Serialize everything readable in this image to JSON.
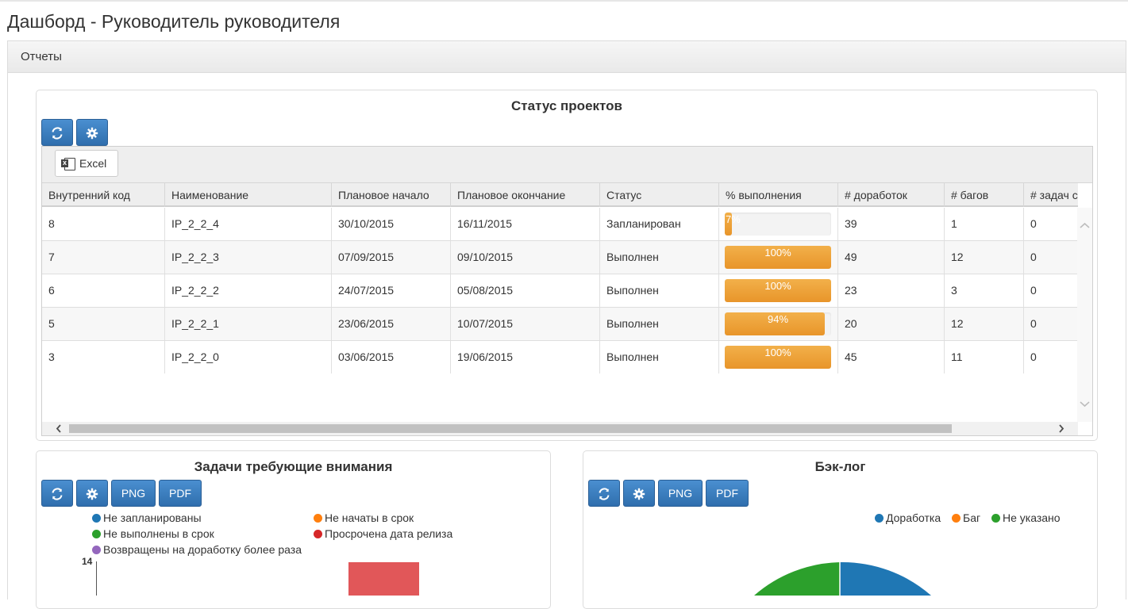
{
  "page": {
    "title": "Дашборд - Руководитель руководителя"
  },
  "reports": {
    "header": "Отчеты"
  },
  "icons": {
    "refresh": "refresh-icon",
    "settings": "gear-icon",
    "excel": "excel-icon"
  },
  "project_status": {
    "title": "Статус проектов",
    "excel_label": "Excel",
    "columns": [
      "Внутренний код",
      "Наименование",
      "Плановое начало",
      "Плановое окончание",
      "Статус",
      "% выполнения",
      "# доработок",
      "# багов",
      "# задач с"
    ],
    "rows": [
      {
        "code": "8",
        "name": "IP_2_2_4",
        "start": "30/10/2015",
        "end": "16/11/2015",
        "status": "Запланирован",
        "progress": 7,
        "progress_label": "7%",
        "rework": "39",
        "bugs": "1",
        "tasks": "0"
      },
      {
        "code": "7",
        "name": "IP_2_2_3",
        "start": "07/09/2015",
        "end": "09/10/2015",
        "status": "Выполнен",
        "progress": 100,
        "progress_label": "100%",
        "rework": "49",
        "bugs": "12",
        "tasks": "0"
      },
      {
        "code": "6",
        "name": "IP_2_2_2",
        "start": "24/07/2015",
        "end": "05/08/2015",
        "status": "Выполнен",
        "progress": 100,
        "progress_label": "100%",
        "rework": "23",
        "bugs": "3",
        "tasks": "0"
      },
      {
        "code": "5",
        "name": "IP_2_2_1",
        "start": "23/06/2015",
        "end": "10/07/2015",
        "status": "Выполнен",
        "progress": 94,
        "progress_label": "94%",
        "rework": "20",
        "bugs": "12",
        "tasks": "0"
      },
      {
        "code": "3",
        "name": "IP_2_2_0",
        "start": "03/06/2015",
        "end": "19/06/2015",
        "status": "Выполнен",
        "progress": 100,
        "progress_label": "100%",
        "rework": "45",
        "bugs": "11",
        "tasks": "0"
      }
    ]
  },
  "tasks_attention": {
    "title": "Задачи требующие внимания",
    "png_label": "PNG",
    "pdf_label": "PDF",
    "legend": [
      {
        "label": "Не запланированы",
        "color": "#1f77b4"
      },
      {
        "label": "Не начаты в срок",
        "color": "#ff7f0e"
      },
      {
        "label": "Не выполнены в срок",
        "color": "#2ca02c"
      },
      {
        "label": "Просрочена дата релиза",
        "color": "#d62728"
      },
      {
        "label": "Возвращены на доработку более раза",
        "color": "#9467bd"
      }
    ],
    "y_max_label": "14",
    "bar_color": "#e15759"
  },
  "backlog": {
    "title": "Бэк-лог",
    "png_label": "PNG",
    "pdf_label": "PDF",
    "legend": [
      {
        "label": "Доработка",
        "color": "#1f77b4"
      },
      {
        "label": "Баг",
        "color": "#ff7f0e"
      },
      {
        "label": "Не указано",
        "color": "#2ca02c"
      }
    ]
  },
  "chart_data": [
    {
      "type": "bar",
      "title": "Задачи требующие внимания",
      "ymax_tick": 14,
      "series": [
        {
          "name": "Просрочена дата релиза",
          "values": [
            14
          ]
        }
      ]
    },
    {
      "type": "pie",
      "title": "Бэк-лог",
      "series_names": [
        "Доработка",
        "Баг",
        "Не указано"
      ]
    }
  ]
}
